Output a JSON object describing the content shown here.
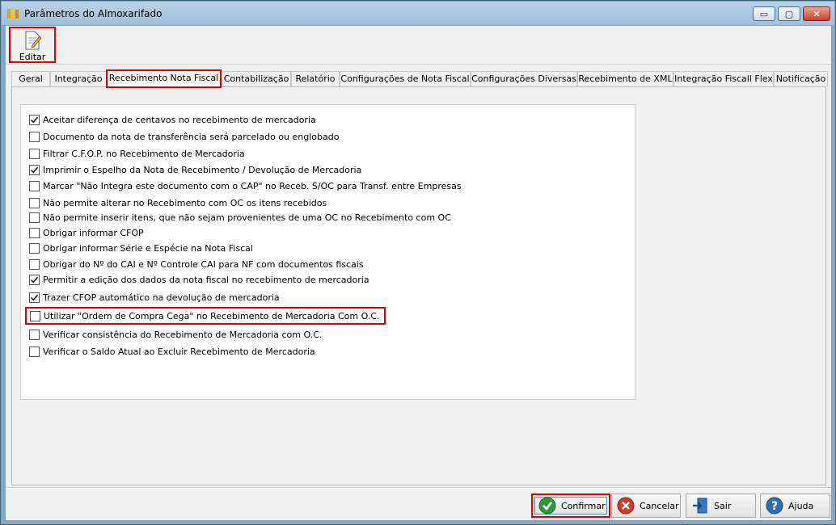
{
  "window": {
    "title": "Parâmetros do Almoxarifado",
    "controls": {
      "minimize": "▭",
      "maximize": "▢",
      "close": "✕"
    }
  },
  "toolbar": {
    "edit_label": "Editar"
  },
  "tabs": [
    {
      "label": "Geral",
      "active": false
    },
    {
      "label": "Integração",
      "active": false
    },
    {
      "label": "Recebimento Nota Fiscal",
      "active": true
    },
    {
      "label": "Contabilização",
      "active": false
    },
    {
      "label": "Relatório",
      "active": false
    },
    {
      "label": "Configurações de Nota Fiscal",
      "active": false
    },
    {
      "label": "Configurações Diversas",
      "active": false
    },
    {
      "label": "Recebimento de XML",
      "active": false
    },
    {
      "label": "Integração Fiscall Flex",
      "active": false
    },
    {
      "label": "Notificação",
      "active": false
    }
  ],
  "options": [
    {
      "label": "Aceitar diferença de centavos no recebimento de mercadoria",
      "checked": true
    },
    {
      "label": "Documento da nota de transferência será parcelado ou englobado",
      "checked": false
    },
    {
      "label": "Filtrar C.F.O.P. no Recebimento de Mercadoria",
      "checked": false
    },
    {
      "label": "Imprimir o Espelho da Nota de Recebimento / Devolução de Mercadoria",
      "checked": true
    },
    {
      "label": "Marcar \"Não Integra este documento com o CAP\" no Receb. S/OC para Transf. entre Empresas",
      "checked": false
    },
    {
      "label": "Não permite alterar no Recebimento com OC os itens recebidos",
      "checked": false
    },
    {
      "label": "Não permite inserir itens, que não sejam provenientes de uma OC no Recebimento com OC",
      "checked": false
    },
    {
      "label": "Obrigar informar CFOP",
      "checked": false
    },
    {
      "label": "Obrigar informar Série e Espécie na Nota Fiscal",
      "checked": false
    },
    {
      "label": "Obrigar do Nº do CAI e Nº Controle CAI para NF com documentos fiscais",
      "checked": false
    },
    {
      "label": "Permitir a edição dos dados da nota fiscal no recebimento de mercadoria",
      "checked": true
    },
    {
      "label": "Trazer CFOP automático na devolução de mercadoria",
      "checked": true
    },
    {
      "label": "Utilizar \"Ordem de Compra Cega\" no Recebimento de Mercadoria Com O.C.",
      "checked": false
    },
    {
      "label": "Verificar consistência do Recebimento de Mercadoria com O.C.",
      "checked": false
    },
    {
      "label": "Verificar o Saldo Atual ao Excluir Recebimento de Mercadoria",
      "checked": false
    }
  ],
  "footer": {
    "confirm_label": "Confirmar",
    "cancel_label": "Cancelar",
    "exit_label": "Sair",
    "help_label": "Ajuda"
  },
  "colors": {
    "highlight": "#e00000",
    "accent": "#2f6fb0",
    "confirm_green": "#2e9a3e",
    "cancel_red": "#d23a2a"
  }
}
